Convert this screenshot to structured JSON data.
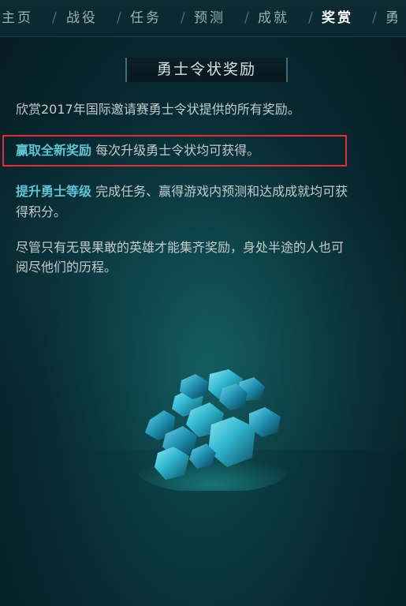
{
  "nav": {
    "items": [
      "主页",
      "战役",
      "任务",
      "预测",
      "成就",
      "奖赏",
      "勇"
    ],
    "active_index": 5,
    "separator": "/"
  },
  "title": "勇士令状奖励",
  "intro": "欣赏2017年国际邀请赛勇士令状提供的所有奖励。",
  "rewards": {
    "label": "赢取全新奖励",
    "text": "每次升级勇士令状均可获得。"
  },
  "levelup": {
    "label": "提升勇士等级",
    "text_line1": "完成任务、赢得游戏内预测和达成成就均可获",
    "text_line2": "得积分。"
  },
  "closing": {
    "line1": "尽管只有无畏果敢的英雄才能集齐奖励，身处半途的人也可",
    "line2": "阅尽他们的历程。"
  },
  "colors": {
    "accent": "#5fc4d3",
    "highlight_box": "#e52a3a",
    "gem": "#2fb6cf"
  },
  "image": {
    "icon": "gem-cluster-icon"
  }
}
